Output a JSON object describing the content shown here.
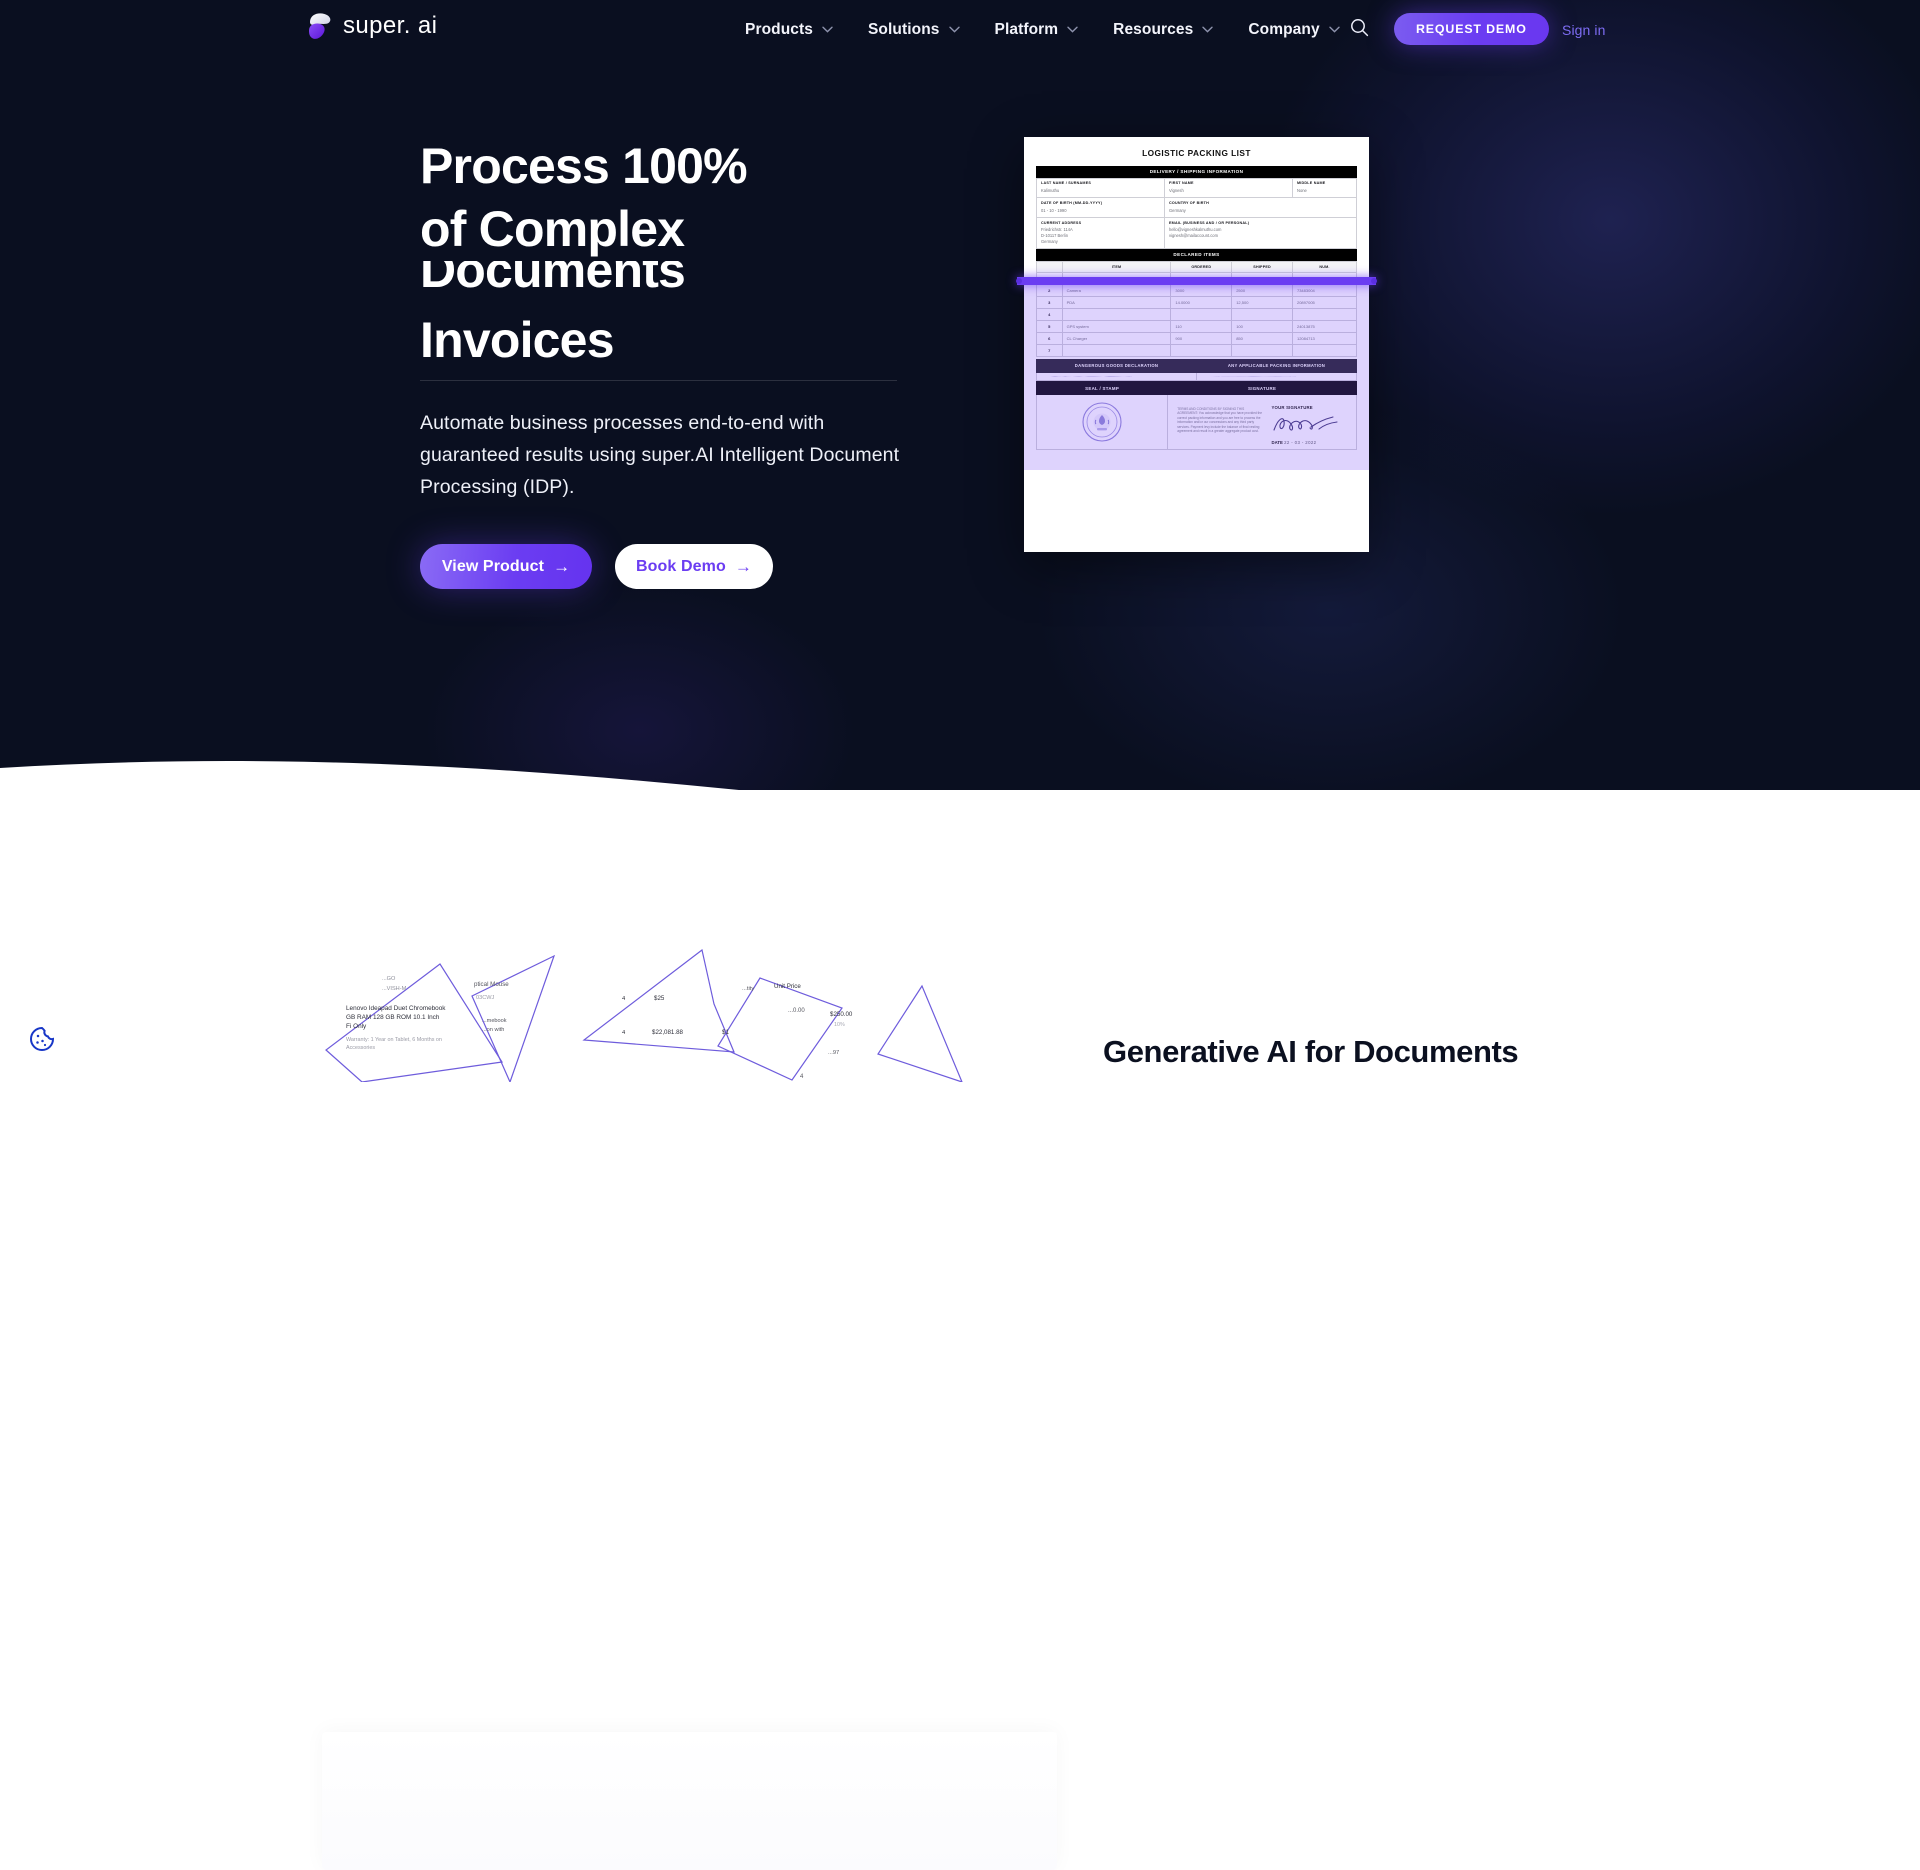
{
  "brand": {
    "name": "super. ai",
    "logo_icon": "superai-logo-icon",
    "accent": "#6b3df2",
    "dark_bg": "#0a0f20"
  },
  "nav": {
    "items": [
      {
        "label": "Products",
        "has_dropdown": true
      },
      {
        "label": "Solutions",
        "has_dropdown": true
      },
      {
        "label": "Platform",
        "has_dropdown": true
      },
      {
        "label": "Resources",
        "has_dropdown": true
      },
      {
        "label": "Company",
        "has_dropdown": true
      }
    ],
    "search_icon": "search-icon",
    "demo_button": "REQUEST DEMO",
    "signin": "Sign in"
  },
  "hero": {
    "headline_line1": "Process 100%",
    "headline_line2": "of Complex",
    "rotating_current": "Documents",
    "rotating_next": "Invoices",
    "subtitle": "Automate business processes end-to-end with guaranteed results using super.AI Intelligent Document Processing (IDP).",
    "cta_primary": "View Product",
    "cta_secondary": "Book Demo",
    "cta_arrow": "→"
  },
  "document": {
    "title": "LOGISTIC PACKING LIST",
    "band_shipping": "DELIVERY / SHIPPING INFORMATION",
    "band_declared": "DECLARED ITEMS",
    "fields": [
      {
        "label": "LAST NAME / SURNAMES",
        "value": "Kalimuthu"
      },
      {
        "label": "FIRST NAME",
        "value": "Vignesh"
      },
      {
        "label": "MIDDLE NAME",
        "value": "None"
      },
      {
        "label": "DATE OF BIRTH (MM-DD-YYYY)",
        "value": "01 - 10 - 1990"
      },
      {
        "label": "COUNTRY OF BIRTH",
        "value": "Germany"
      },
      {
        "label": "CURRENT ADDRESS",
        "value": "Friedrichstr. 114A\nD-10117 Berlin\nGermany"
      },
      {
        "label": "EMAIL (BUSINESS AND / OR PERSONAL)",
        "value": "hello@vigneshkalmuthu.com\nvignesh@mailaccount.com"
      }
    ],
    "items_headers": [
      "",
      "ITEM",
      "ORDERED",
      "SHIPPED",
      "NUM."
    ],
    "items_rows": [
      [
        "1",
        "Hard Drive",
        "125",
        "125",
        "34186504"
      ],
      [
        "2",
        "Camera",
        "3000",
        "2500",
        "73483004"
      ],
      [
        "3",
        "PDA",
        "14.0000",
        "12,500",
        "20897005"
      ],
      [
        "4",
        "",
        "",
        "",
        ""
      ],
      [
        "5",
        "GPS system",
        "110",
        "100",
        "24013875"
      ],
      [
        "6",
        "CL Charger",
        "900",
        "850",
        "12084713"
      ],
      [
        "7",
        "",
        "",
        "",
        ""
      ]
    ],
    "dangerous_goods_header": "DANGEROUS GOODS DECLARATION",
    "packing_info_header": "ANY APPLICABLE PACKING INFORMATION",
    "seal_header": "SEAL / STAMP",
    "signature_header": "SIGNATURE",
    "terms_text": "TERMS AND CONDITIONS BY SIGNING THIS AGREEMENT: You acknowledge that you have provided the correct packing information and you are free to process the information and/or our concessions and any third party services. Payment levy include the balance of final vesting agreement and result in a greater aggregate product cost.",
    "signature_label": "YOUR SIGNATURE",
    "date_label": "DATE",
    "date_value": "22 - 03 - 2022",
    "seal_icon": "official-seal-icon",
    "signature_icon": "handwritten-signature-icon",
    "highlight_color": "#6b3df2"
  },
  "lower": {
    "section_title": "Generative AI for Documents",
    "shards": [
      {
        "lines": [
          "...GO",
          "...VISH-M",
          "Lenovo Ideapad Duet Chromebook",
          "GB RAM 128 GB ROM 10.1 Inch",
          "Fi Only",
          "Warranty: 1 Year on Tablet, 6 Months on Accessories"
        ]
      },
      {
        "lines": [
          "ptical Mouse",
          "03CWJ",
          "...mebook",
          "...on with"
        ]
      },
      {
        "lines": [
          "4",
          "$25",
          "4",
          "$22,081.88",
          "$1"
        ]
      },
      {
        "lines": [
          "...tity",
          "Unit Price",
          "...0.00",
          "$250.00",
          "10%",
          "...97"
        ]
      }
    ]
  },
  "cookie": {
    "icon": "cookie-icon",
    "color": "#1736c7"
  }
}
